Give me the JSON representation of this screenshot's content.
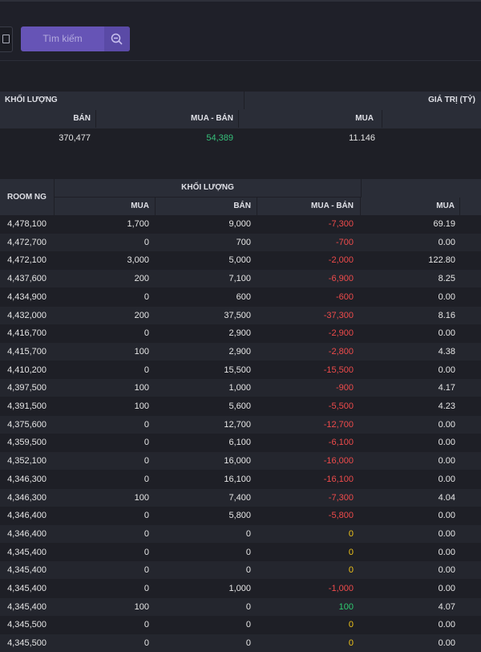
{
  "search": {
    "label": "Tìm kiếm"
  },
  "summary": {
    "group_volume": "KHỐI LƯỢNG",
    "group_value": "GIÁ TRỊ (TỶ)",
    "col_sell": "BÁN",
    "col_net": "MUA - BÁN",
    "col_buy": "MUA",
    "row": {
      "sell": "370,477",
      "net": "54,389",
      "buy_value": "11.146"
    }
  },
  "table": {
    "header": {
      "room": "ROOM NG",
      "group_volume": "KHỐI LƯỢNG",
      "buy": "MUA",
      "sell": "BÁN",
      "net": "MUA - BÁN",
      "value_buy": "MUA"
    },
    "rows": [
      {
        "room": "4,478,100",
        "buy": "1,700",
        "sell": "9,000",
        "net": "-7,300",
        "net_type": "neg",
        "value": "69.19"
      },
      {
        "room": "4,472,700",
        "buy": "0",
        "sell": "700",
        "net": "-700",
        "net_type": "neg",
        "value": "0.00"
      },
      {
        "room": "4,472,100",
        "buy": "3,000",
        "sell": "5,000",
        "net": "-2,000",
        "net_type": "neg",
        "value": "122.80"
      },
      {
        "room": "4,437,600",
        "buy": "200",
        "sell": "7,100",
        "net": "-6,900",
        "net_type": "neg",
        "value": "8.25"
      },
      {
        "room": "4,434,900",
        "buy": "0",
        "sell": "600",
        "net": "-600",
        "net_type": "neg",
        "value": "0.00"
      },
      {
        "room": "4,432,000",
        "buy": "200",
        "sell": "37,500",
        "net": "-37,300",
        "net_type": "neg",
        "value": "8.16"
      },
      {
        "room": "4,416,700",
        "buy": "0",
        "sell": "2,900",
        "net": "-2,900",
        "net_type": "neg",
        "value": "0.00"
      },
      {
        "room": "4,415,700",
        "buy": "100",
        "sell": "2,900",
        "net": "-2,800",
        "net_type": "neg",
        "value": "4.38"
      },
      {
        "room": "4,410,200",
        "buy": "0",
        "sell": "15,500",
        "net": "-15,500",
        "net_type": "neg",
        "value": "0.00"
      },
      {
        "room": "4,397,500",
        "buy": "100",
        "sell": "1,000",
        "net": "-900",
        "net_type": "neg",
        "value": "4.17"
      },
      {
        "room": "4,391,500",
        "buy": "100",
        "sell": "5,600",
        "net": "-5,500",
        "net_type": "neg",
        "value": "4.23"
      },
      {
        "room": "4,375,600",
        "buy": "0",
        "sell": "12,700",
        "net": "-12,700",
        "net_type": "neg",
        "value": "0.00"
      },
      {
        "room": "4,359,500",
        "buy": "0",
        "sell": "6,100",
        "net": "-6,100",
        "net_type": "neg",
        "value": "0.00"
      },
      {
        "room": "4,352,100",
        "buy": "0",
        "sell": "16,000",
        "net": "-16,000",
        "net_type": "neg",
        "value": "0.00"
      },
      {
        "room": "4,346,300",
        "buy": "0",
        "sell": "16,100",
        "net": "-16,100",
        "net_type": "neg",
        "value": "0.00"
      },
      {
        "room": "4,346,300",
        "buy": "100",
        "sell": "7,400",
        "net": "-7,300",
        "net_type": "neg",
        "value": "4.04"
      },
      {
        "room": "4,346,400",
        "buy": "0",
        "sell": "5,800",
        "net": "-5,800",
        "net_type": "neg",
        "value": "0.00"
      },
      {
        "room": "4,346,400",
        "buy": "0",
        "sell": "0",
        "net": "0",
        "net_type": "zero",
        "value": "0.00"
      },
      {
        "room": "4,345,400",
        "buy": "0",
        "sell": "0",
        "net": "0",
        "net_type": "zero",
        "value": "0.00"
      },
      {
        "room": "4,345,400",
        "buy": "0",
        "sell": "0",
        "net": "0",
        "net_type": "zero",
        "value": "0.00"
      },
      {
        "room": "4,345,400",
        "buy": "0",
        "sell": "1,000",
        "net": "-1,000",
        "net_type": "neg",
        "value": "0.00"
      },
      {
        "room": "4,345,400",
        "buy": "100",
        "sell": "0",
        "net": "100",
        "net_type": "pos",
        "value": "4.07"
      },
      {
        "room": "4,345,500",
        "buy": "0",
        "sell": "0",
        "net": "0",
        "net_type": "zero",
        "value": "0.00"
      },
      {
        "room": "4,345,500",
        "buy": "0",
        "sell": "0",
        "net": "0",
        "net_type": "zero",
        "value": "0.00"
      }
    ]
  },
  "colors": {
    "negative": "#ef4b4b",
    "positive": "#2ecc71",
    "zero": "#f0c419",
    "accent": "#6654b6"
  },
  "icons": {
    "search": "magnifier-minus-icon",
    "calendar": "calendar-icon"
  }
}
